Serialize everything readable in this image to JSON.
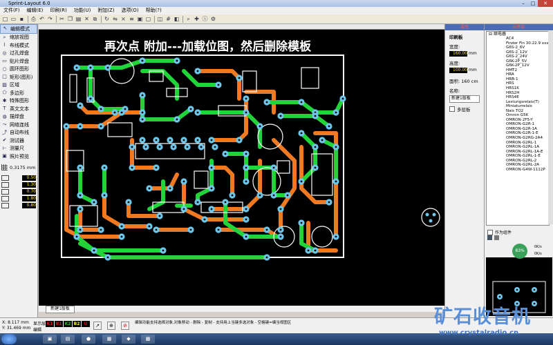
{
  "app": {
    "title": "Sprint-Layout 6.0"
  },
  "window_buttons": {
    "minimize": "–",
    "maximize": "□",
    "close": "✕"
  },
  "menu": [
    "文件(F)",
    "编辑(E)",
    "印刷(R)",
    "功能(U)",
    "附加(Z)",
    "选项(O)",
    "帮助(?)"
  ],
  "toolbar": {
    "icons": [
      "new-icon",
      "open-icon",
      "save-icon",
      "print-icon",
      "undo-icon",
      "redo-icon",
      "cut-icon",
      "copy-icon",
      "paste-icon",
      "delete-icon",
      "duplicate-icon",
      "rotate-icon",
      "mirror-icon",
      "x2-icon",
      "align-icon",
      "group-icon",
      "ungroup-icon",
      "layer-icon",
      "grid-icon",
      "component-icon",
      "zoom-icon",
      "pick-icon",
      "info-icon",
      "settings-icon"
    ],
    "zoom_text": "×2"
  },
  "tools": [
    {
      "label": "编辑模式",
      "icon": "arrow-icon",
      "active": true
    },
    {
      "label": "缩放视图",
      "icon": "magnifier-icon"
    },
    {
      "label": "布线模式",
      "icon": "track-icon"
    },
    {
      "label": "过孔焊盘",
      "icon": "via-icon"
    },
    {
      "label": "贴片焊盘",
      "icon": "smd-icon"
    },
    {
      "label": "圆环图形",
      "icon": "circle-icon"
    },
    {
      "label": "矩形(图形)",
      "icon": "rect-icon"
    },
    {
      "label": "区域",
      "icon": "zone-icon"
    },
    {
      "label": "多边形",
      "icon": "polygon-icon"
    },
    {
      "label": "特殊图形",
      "icon": "special-icon"
    },
    {
      "label": "英文文本",
      "icon": "text-icon"
    },
    {
      "label": "描焊盘",
      "icon": "mask-icon"
    },
    {
      "label": "网络连线",
      "icon": "connection-icon"
    },
    {
      "label": "自动布线",
      "icon": "autoroute-icon"
    },
    {
      "label": "测试器",
      "icon": "test-icon"
    },
    {
      "label": "测量尺",
      "icon": "ruler-icon"
    },
    {
      "label": "照片预览",
      "icon": "photo-icon"
    }
  ],
  "grid": {
    "value": "0.3175 mm"
  },
  "layer_widths": [
    {
      "icon": "track-width-icon",
      "value": "0.50"
    },
    {
      "icon": "pad-outer-icon",
      "value": "1.30"
    },
    {
      "icon": "pad-inner-icon",
      "value": "0.70"
    },
    {
      "icon": "smd-width-icon",
      "value": "1.80"
    },
    {
      "icon": "smd-height-icon",
      "value": "0.80"
    }
  ],
  "canvas": {
    "annotation": "再次点 附加---加载位图，然后删除模板",
    "annotation_color": "#ffffff"
  },
  "board_panel": {
    "header": "属性",
    "title": "印刷板",
    "width_label": "宽度:",
    "width_value": "160.00",
    "height_label": "高度:",
    "height_value": "100.00",
    "unit": "mm",
    "area_label": "面积:",
    "area_value": "160 cm",
    "name_label": "名称:",
    "name_value": "新建1版板",
    "multilayer_label": "多层板"
  },
  "library": {
    "header": "元件库",
    "root": "继电器",
    "items": [
      "AC4",
      "Finder Fin 30.22.9 xxxV",
      "G6S-2_6V",
      "G6S-2_12V",
      "G6S-2_24V",
      "G6K-2P_5V",
      "G6K-2P_12V",
      "HMT2",
      "HRA",
      "HRB-1",
      "HRS",
      "HRS1K",
      "HRS2H",
      "HRS4E",
      "Lestungsrelais(T)",
      "Miniaturrelais",
      "Nais TQ2",
      "Omron G5K",
      "OMRON-2F5-Y",
      "OMRON-G2R-1",
      "OMRON-G2R-1A",
      "OMRON-G2R-1-E",
      "OMRON-G2RG-2A4",
      "OMRON-G2RL-1",
      "OMRON-G2RL-1A",
      "OMRON-G2RL-1A-E",
      "OMRON-G2RL-1-E",
      "OMRON-G2RL-2",
      "OMRON-G2RL-2A",
      "OMRON-G4W-1112P"
    ],
    "as_component_label": "作为组件",
    "macro_badge": "83%",
    "speed_up": "0K/s",
    "speed_down": "0K/s"
  },
  "status": {
    "x_label": "X:",
    "x_value": "8.117 mm",
    "y_label": "Y:",
    "y_value": "31.469 mm",
    "layer_label": "显示层",
    "edit_label": "编辑",
    "layers": [
      {
        "name": "K1",
        "color": "#e01010"
      },
      {
        "name": "B1",
        "color": "#e01010"
      },
      {
        "name": "K2",
        "color": "#20c020"
      },
      {
        "name": "B2",
        "color": "#ffff00"
      },
      {
        "name": "U",
        "color": "#e01010"
      }
    ],
    "hint_line1": "编辑功能支持选择对象,对象移动 - 删除 - 复制 - 支持用上当键多选对象 - 空格键=编当视图区",
    "hint_line2": ""
  },
  "tab": {
    "label": "新建1版板"
  },
  "watermark": {
    "text": "矿石收音机",
    "url": "www.crystalradio.cn"
  }
}
